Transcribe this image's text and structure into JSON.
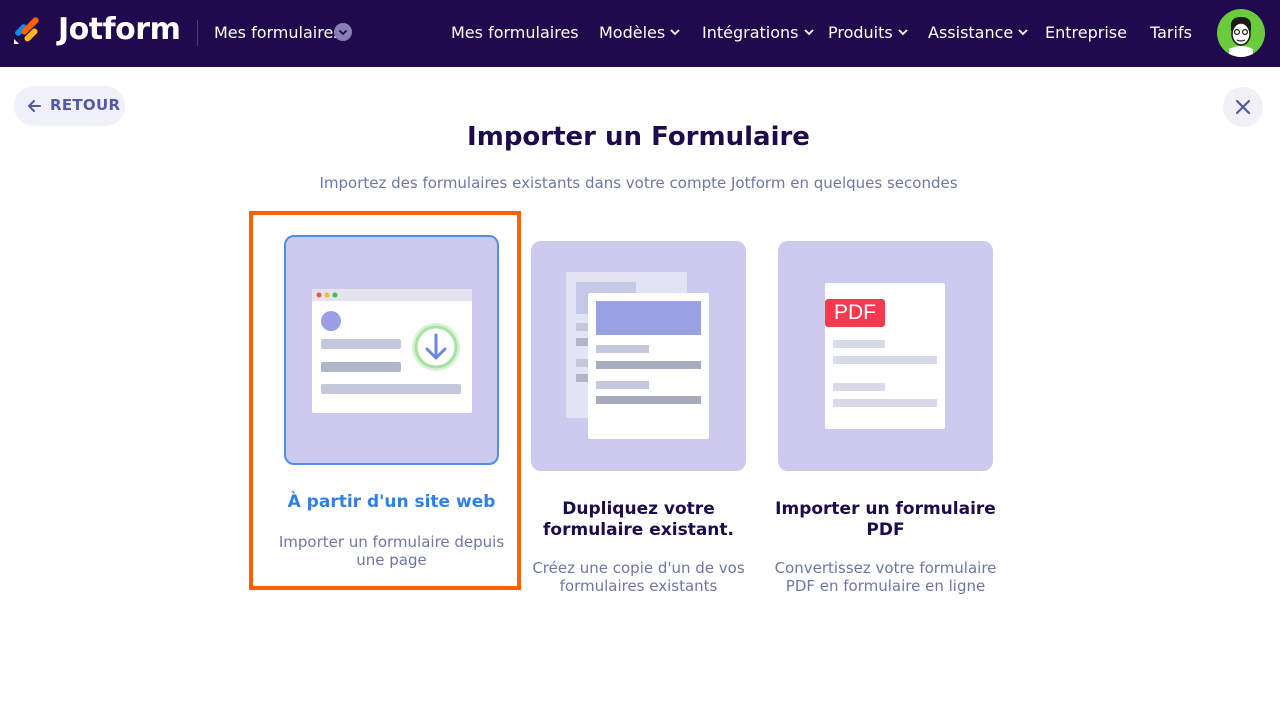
{
  "header": {
    "brand": "Jotform",
    "my_forms_menu": "Mes formulaires",
    "nav": [
      {
        "label": "Mes formulaires",
        "has_dropdown": false
      },
      {
        "label": "Modèles",
        "has_dropdown": true
      },
      {
        "label": "Intégrations",
        "has_dropdown": true
      },
      {
        "label": "Produits",
        "has_dropdown": true
      },
      {
        "label": "Assistance",
        "has_dropdown": true
      },
      {
        "label": "Entreprise",
        "has_dropdown": false
      },
      {
        "label": "Tarifs",
        "has_dropdown": false
      }
    ]
  },
  "back_label": "RETOUR",
  "page": {
    "title": "Importer un Formulaire",
    "subtitle": "Importez des formulaires existants dans votre compte Jotform en quelques secondes"
  },
  "options": [
    {
      "title": "À partir d'un site web",
      "description": "Importer un formulaire depuis une page",
      "selected": true
    },
    {
      "title": "Dupliquez votre formulaire existant.",
      "description": "Créez une copie d'un de vos formulaires existants",
      "selected": false
    },
    {
      "title": "Importer un formulaire PDF",
      "description": "Convertissez votre formulaire PDF en formulaire en ligne",
      "badge": "PDF",
      "selected": false
    }
  ],
  "colors": {
    "header_bg": "#21094e",
    "card_bg": "#cccaee",
    "selected_text": "#2f81e8",
    "highlight": "#ff6100",
    "pdf_badge": "#f33a4f"
  }
}
